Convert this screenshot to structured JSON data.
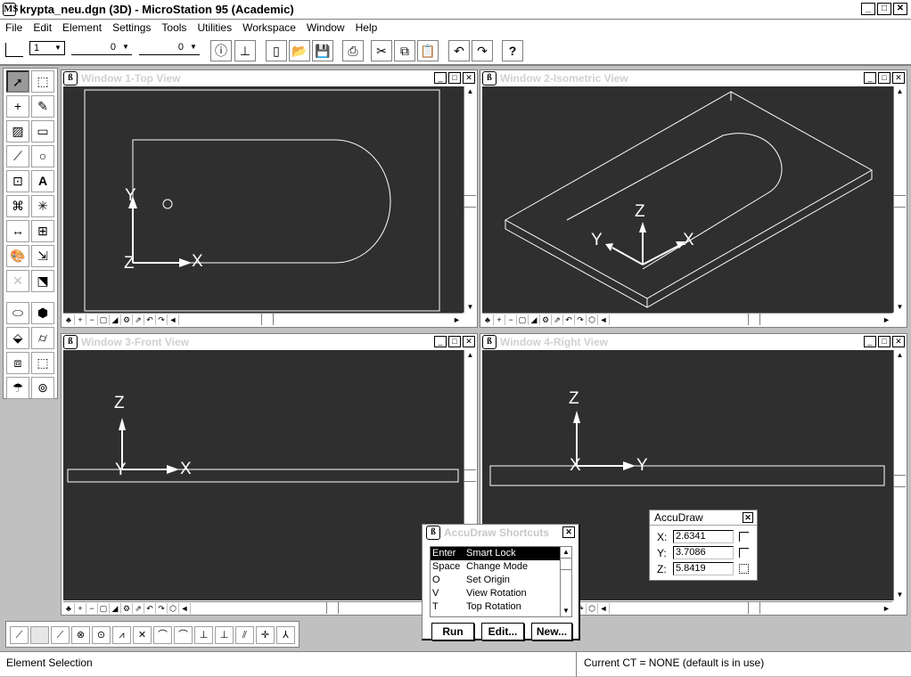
{
  "app": {
    "title": "krypta_neu.dgn (3D) - MicroStation 95 (Academic)",
    "logo": "MS"
  },
  "menu": [
    "File",
    "Edit",
    "Element",
    "Settings",
    "Tools",
    "Utilities",
    "Workspace",
    "Window",
    "Help"
  ],
  "toolbar": {
    "level": "1",
    "style": "0",
    "weight": "0",
    "help": "?"
  },
  "views": [
    {
      "title": "Window 1-Top View"
    },
    {
      "title": "Window 2-Isometric View"
    },
    {
      "title": "Window 3-Front View"
    },
    {
      "title": "Window 4-Right View"
    }
  ],
  "axes": {
    "top": {
      "a": "Y",
      "b": "X",
      "c": "Z"
    },
    "iso": {
      "a": "Z",
      "b": "X",
      "c": "Y"
    },
    "front": {
      "a": "Z",
      "b": "X",
      "c": "Y"
    },
    "right": {
      "a": "Z",
      "b": "Y",
      "c": "X"
    }
  },
  "shortcuts": {
    "title": "AccuDraw Shortcuts",
    "items": [
      {
        "key": "Enter",
        "action": "Smart Lock",
        "selected": true
      },
      {
        "key": "Space",
        "action": "Change Mode"
      },
      {
        "key": "O",
        "action": "Set Origin"
      },
      {
        "key": "V",
        "action": "View Rotation"
      },
      {
        "key": "T",
        "action": "Top Rotation"
      }
    ],
    "run": "Run",
    "edit": "Edit...",
    "new": "New..."
  },
  "accudraw": {
    "title": "AccuDraw",
    "x_label": "X:",
    "x": "2.6341",
    "y_label": "Y:",
    "y": "3.7086",
    "z_label": "Z:",
    "z": "5.8419"
  },
  "status": {
    "left": "Element Selection",
    "right": "Current CT = NONE (default is in use)"
  },
  "colors": {
    "viewBackground": "#2f2f2f",
    "viewGeometry": "#ffffff"
  }
}
